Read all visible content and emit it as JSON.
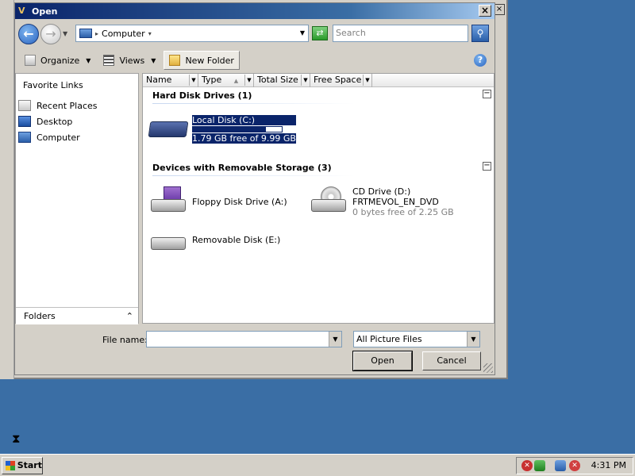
{
  "dialog": {
    "title": "Open",
    "close_glyph": "×"
  },
  "navbar": {
    "back_glyph": "←",
    "forward_glyph": "→",
    "address": "Computer",
    "search_placeholder": "Search",
    "search_glyph": "⚲",
    "refresh_glyph": "⇄"
  },
  "toolbar": {
    "organize_label": "Organize",
    "views_label": "Views",
    "new_folder_label": "New Folder",
    "help_glyph": "?"
  },
  "favorites": {
    "title": "Favorite Links",
    "items": [
      {
        "label": "Recent Places",
        "icon": "recent-places-icon"
      },
      {
        "label": "Desktop",
        "icon": "desktop-icon"
      },
      {
        "label": "Computer",
        "icon": "computer-icon"
      }
    ],
    "folders_label": "Folders",
    "folders_chevron": "⌃"
  },
  "columns": [
    {
      "label": "Name"
    },
    {
      "label": "Type"
    },
    {
      "label": "Total Size"
    },
    {
      "label": "Free Space"
    }
  ],
  "groups": [
    {
      "title": "Hard Disk Drives (1)",
      "collapse_glyph": "−",
      "drives": [
        {
          "name": "Local Disk (C:)",
          "detail": "1.79 GB free of 9.99 GB",
          "used_fraction": 0.82,
          "selected": true
        }
      ]
    },
    {
      "title": "Devices with Removable Storage (3)",
      "collapse_glyph": "−",
      "drives": [
        {
          "name": "Floppy Disk Drive (A:)"
        },
        {
          "name": "CD Drive (D:)",
          "volume": "FRTMEVOL_EN_DVD",
          "detail": "0 bytes free of 2.25 GB"
        },
        {
          "name": "Removable Disk (E:)"
        }
      ]
    }
  ],
  "bottom": {
    "file_name_label": "File name:",
    "file_name_value": "",
    "file_type_value": "All Picture Files",
    "open_label": "Open",
    "cancel_label": "Cancel"
  },
  "taskbar": {
    "start_label": "Start",
    "clock": "4:31 PM"
  },
  "colors": {
    "desktop": "#3a6ea5",
    "selection": "#0a246a",
    "titlebar_start": "#0a246a"
  }
}
